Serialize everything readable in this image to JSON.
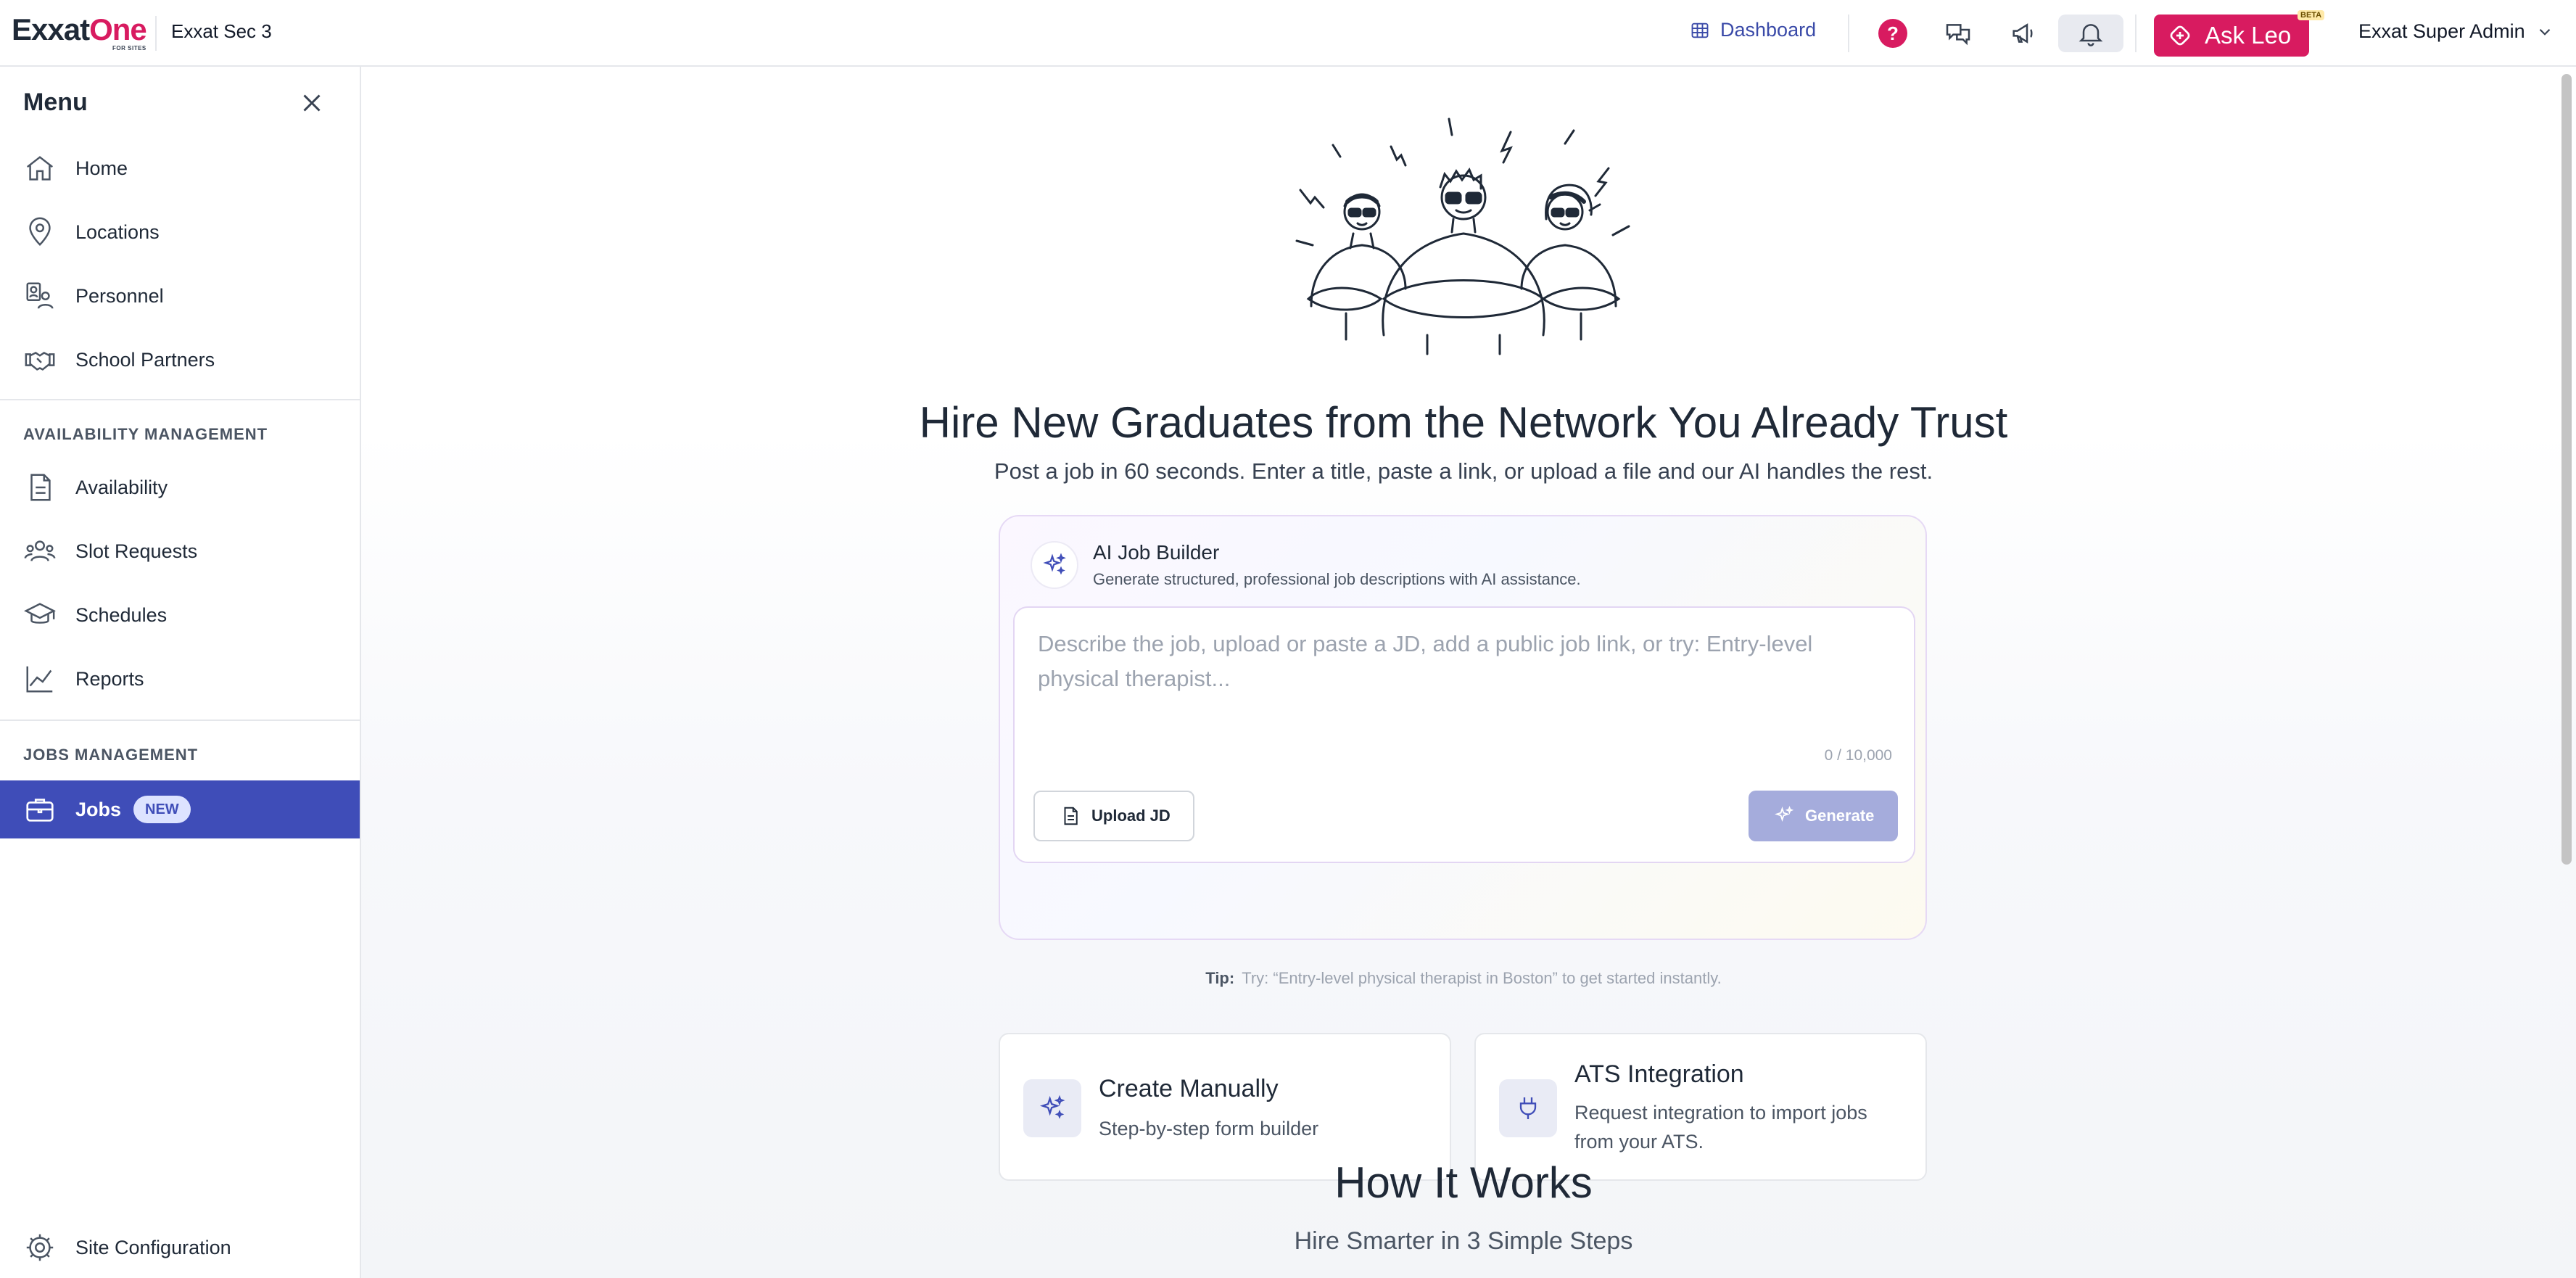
{
  "app": {
    "logo_main": "Exxat",
    "logo_accent": "One",
    "logo_sub": "FOR SITES",
    "site_name": "Exxat Sec 3"
  },
  "topbar": {
    "dashboard_label": "Dashboard",
    "help_glyph": "?",
    "ask_leo_label": "Ask Leo",
    "beta_label": "BETA",
    "user_name": "Exxat Super Admin",
    "icons": [
      "grid-icon",
      "help-icon",
      "chat-icon",
      "megaphone-icon",
      "bell-icon",
      "leo-icon",
      "chevron-down-icon"
    ]
  },
  "sidebar": {
    "title": "Menu",
    "items_top": [
      {
        "label": "Home",
        "icon": "home-icon"
      },
      {
        "label": "Locations",
        "icon": "location-pin-icon"
      },
      {
        "label": "Personnel",
        "icon": "personnel-icon"
      },
      {
        "label": "School Partners",
        "icon": "handshake-icon"
      }
    ],
    "availability_header": "AVAILABILITY MANAGEMENT",
    "items_availability": [
      {
        "label": "Availability",
        "icon": "document-icon"
      },
      {
        "label": "Slot Requests",
        "icon": "people-icon"
      },
      {
        "label": "Schedules",
        "icon": "graduation-cap-icon"
      },
      {
        "label": "Reports",
        "icon": "line-chart-icon"
      }
    ],
    "jobs_header": "JOBS MANAGEMENT",
    "jobs_item": {
      "label": "Jobs",
      "badge": "NEW",
      "icon": "briefcase-icon"
    },
    "footer_item": {
      "label": "Site Configuration",
      "icon": "gear-icon"
    }
  },
  "hero": {
    "title": "Hire New Graduates from the Network You Already Trust",
    "subtitle": "Post a job in 60 seconds. Enter a title, paste a link, or upload a file and our AI handles the rest."
  },
  "ai_builder": {
    "title": "AI Job Builder",
    "description": "Generate structured, professional job descriptions with AI assistance.",
    "input_value": "",
    "placeholder": "Describe the job, upload or paste a JD, add a public job link, or try: Entry-level physical therapist...",
    "char_count": "0 / 10,000",
    "upload_label": "Upload JD",
    "generate_label": "Generate"
  },
  "tip": {
    "label": "Tip:",
    "text": "Try: “Entry-level physical therapist in Boston” to get started instantly."
  },
  "options": [
    {
      "title": "Create Manually",
      "desc": "Step-by-step form builder",
      "icon": "sparkle-icon"
    },
    {
      "title": "ATS Integration",
      "desc_line1": "Request integration to import jobs",
      "desc_line2": "from your ATS.",
      "icon": "plug-icon"
    }
  ],
  "how_it_works": {
    "title": "How It Works",
    "subtitle": "Hire Smarter in 3 Simple Steps"
  },
  "colors": {
    "brand_pink": "#d81b60",
    "nav_active": "#3f4db8",
    "dashboard_link": "#3a4aa8",
    "generate_disabled": "#a5acdc"
  }
}
